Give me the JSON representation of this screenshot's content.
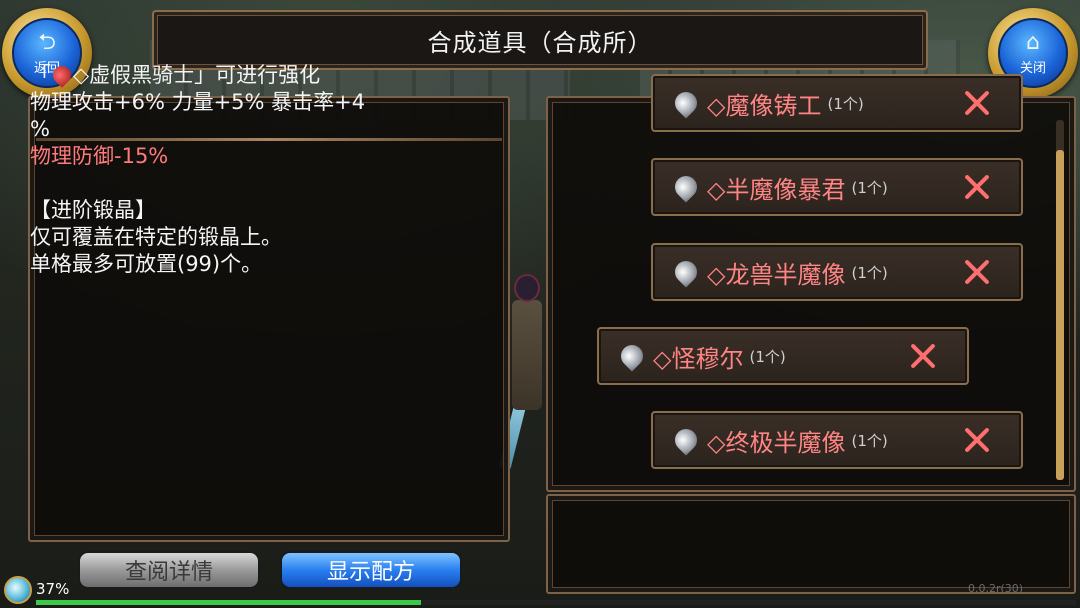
{
  "header": {
    "title": "合成道具（合成所）",
    "back_button": {
      "label": "返回",
      "icon": "return-arrow-icon"
    },
    "close_button": {
      "label": "关闭",
      "icon": "home-icon"
    }
  },
  "info_panel": {
    "line1_prefix": "「",
    "line1_name": "◇虚假黑骑士",
    "line1_suffix": "」可进行强化",
    "line2": "物理攻击+6% 力量+5% 暴击率+4",
    "line3": "%",
    "line4_red": "物理防御-15%",
    "line5": "【进阶锻晶】",
    "line6": "仅可覆盖在特定的锻晶上。",
    "line7": "单格最多可放置(99)个。"
  },
  "buttons": {
    "detail_label": "查阅详情",
    "recipe_label": "显示配方"
  },
  "crafting_list": {
    "items": [
      {
        "name": "◇魔像铸工",
        "count": "(1个)"
      },
      {
        "name": "◇半魔像暴君",
        "count": "(1个)"
      },
      {
        "name": "◇龙兽半魔像",
        "count": "(1个)"
      },
      {
        "name": "◇怪穆尔",
        "count": "(1个)"
      },
      {
        "name": "◇终极半魔像",
        "count": "(1个)"
      }
    ]
  },
  "status": {
    "percent": "37%",
    "progress": 0.37,
    "version": "0.0.2r(30)"
  },
  "colors": {
    "accent_red": "#ff8484",
    "gold_frame": "#8a6d4c",
    "blue_button": "#2a7ff0",
    "progress_green": "#3cc94a"
  }
}
